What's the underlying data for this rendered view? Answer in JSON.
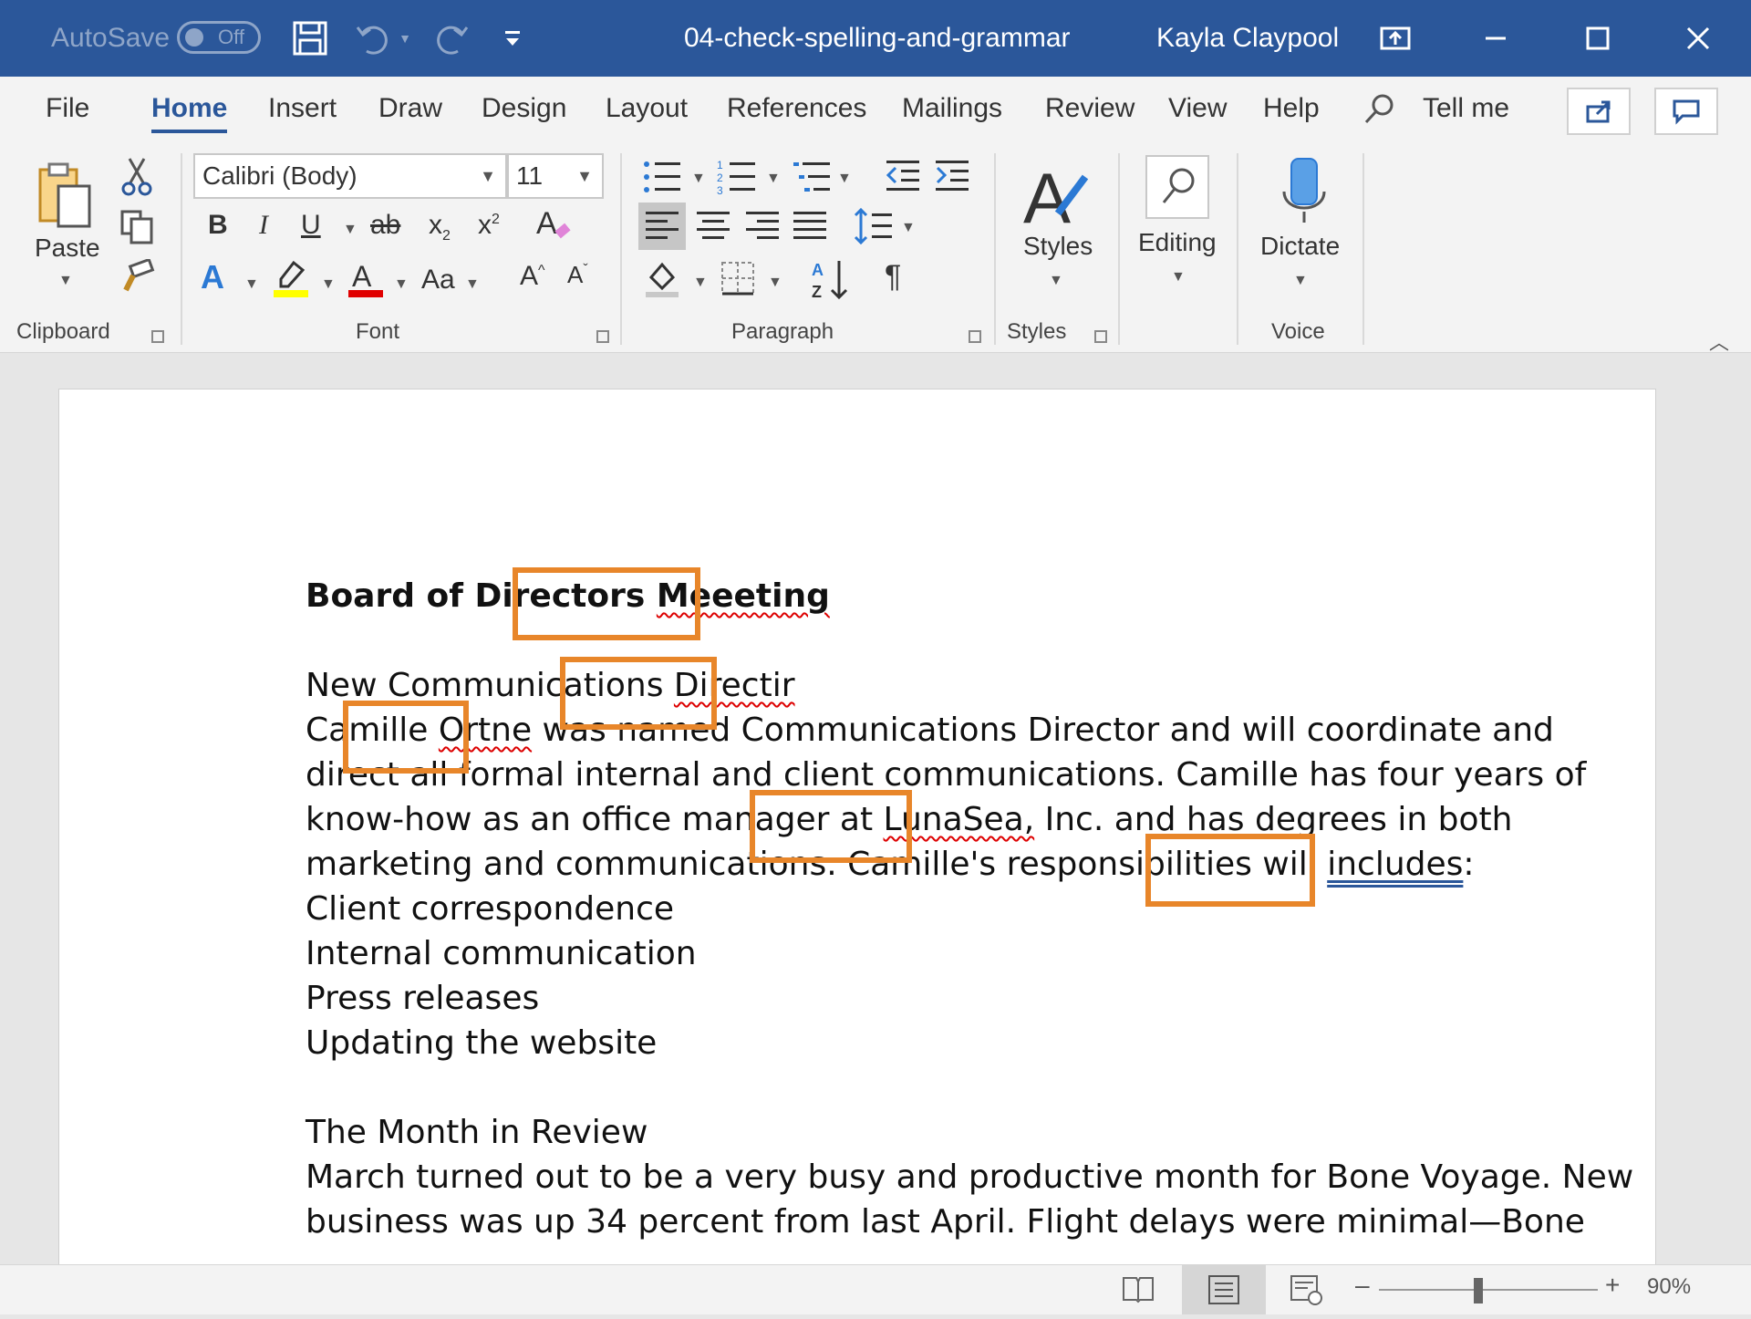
{
  "titlebar": {
    "autosave_label": "AutoSave",
    "autosave_state": "Off",
    "doc_title": "04-check-spelling-and-grammar",
    "user_name": "Kayla Claypool",
    "bg_color": "#2b579a"
  },
  "menu": {
    "tabs": [
      "File",
      "Home",
      "Insert",
      "Draw",
      "Design",
      "Layout",
      "References",
      "Mailings",
      "Review",
      "View",
      "Help"
    ],
    "active_tab": "Home",
    "tell_me": "Tell me"
  },
  "ribbon": {
    "clipboard": {
      "paste_label": "Paste",
      "group_label": "Clipboard"
    },
    "font": {
      "font_name": "Calibri (Body)",
      "font_size": "11",
      "group_label": "Font",
      "aa_label": "Aa"
    },
    "paragraph": {
      "group_label": "Paragraph"
    },
    "styles": {
      "styles_label": "Styles",
      "group_label": "Styles"
    },
    "editing": {
      "editing_label": "Editing"
    },
    "voice": {
      "dictate_label": "Dictate",
      "group_label": "Voice"
    }
  },
  "document": {
    "heading_before": "Board of Directors",
    "heading_err": "Meeeting",
    "line1_before": "New Communications",
    "line1_err": "Directir",
    "line2_a": "Camille",
    "line2_err": "Ortne",
    "line2_b": "was named Communications Director and will coordinate and",
    "line3": "direct all formal internal and client communications. Camille has four years of",
    "line4_a": "know-how as an office manager at",
    "line4_err": "LunaSea,",
    "line4_b": "Inc. and has degrees in both",
    "line5_a": "marketing and communications. Camille's responsibilities will",
    "line5_err": "includes",
    "line5_b": ":",
    "list": [
      "Client correspondence",
      "Internal communication",
      "Press releases",
      "Updating the website"
    ],
    "section2_title": "The Month in Review",
    "para2_line1": "March turned out to be a very busy and productive month for Bone Voyage. New",
    "para2_line2": "business was up 34 percent from last April. Flight delays were minimal—Bone"
  },
  "status": {
    "zoom_label": "90%"
  },
  "colors": {
    "highlight": "#e8862a",
    "spelling_error": "#d00000",
    "grammar_error": "#2b579a"
  }
}
